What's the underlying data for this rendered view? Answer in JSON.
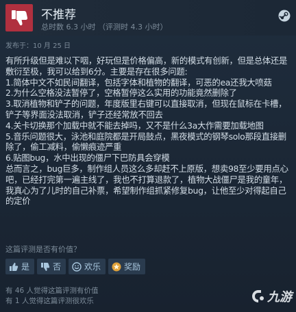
{
  "review": {
    "verdict": "不推荐",
    "hours": "总时数 6.3 小时   （评测时 4.3 小时）",
    "posted": "发布于：10 月 25 日",
    "body": "有所升级但是难以下咽，好玩但是价格偏高，新的模式有创新，但是总体还是敷衍至极，我可以给到6分。主要是存在很多问题:\n1.简体中文不如民间翻译，包括字体和植物的翻译，可恶的ea还我大喷菇\n2.为什么空格没法暂停了，空格暂停这么实用的功能竟然删除了\n3.取消植物和铲子的问题，年度版里右键可以直接取消，但现在鼠标在卡槽，铲子等界面没法取消，铲子还经常放不回去\n4.关卡切换那个加载中就不能去掉吗，又不是什么3a大作需要加载地图\n5.音乐问题很大，泳池和庭院都是开局鼓点，黑夜模式的钢琴solo那段直接删除了，偷工减料，偷懒痕迹严重\n6.贴图bug，水中出现的僵尸下巴防具会穿模\n总而言之，bug巨多，制作组人员这么多却赶不上原版，想卖98至少要用点心吧，已经打完第一遍主线了，我也不打算退款了，植物大战僵尸是我的童年，我真心为了儿时的自己补票，希望制作组抓紧修复bug，让他至少对得起自己的定价"
  },
  "helpful": {
    "prompt": "这篇评测是否有价值？",
    "yes_label": "是",
    "no_label": "否",
    "funny_label": "欢乐",
    "award_label": "奖励"
  },
  "stats": {
    "helpful_count": "有 46 人觉得这篇评测有价值",
    "funny_count": "有 1 人觉得这篇评测很欢乐"
  },
  "watermark": {
    "text": "九游"
  },
  "colors": {
    "verdict_red": "#b0303f",
    "background": "#1b2838",
    "button_bg": "#2a3b4e",
    "award_icon": "#e0a23a"
  }
}
